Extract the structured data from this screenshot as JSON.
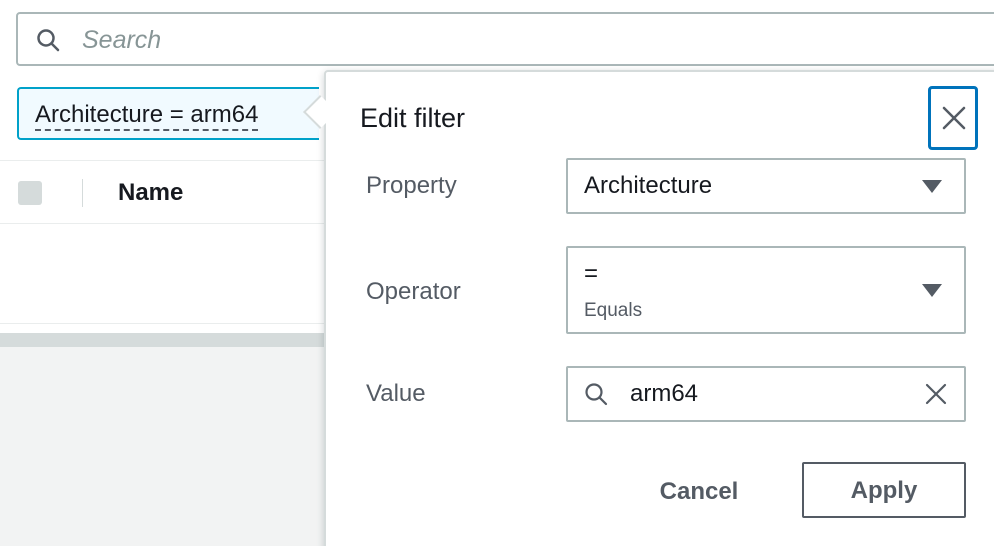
{
  "search": {
    "placeholder": "Search",
    "icon": "search-icon"
  },
  "filter_token": {
    "label": "Architecture = arm64"
  },
  "table": {
    "columns": [
      "Name"
    ]
  },
  "popover": {
    "title": "Edit filter",
    "close_icon": "close-icon",
    "property": {
      "label": "Property",
      "value": "Architecture"
    },
    "operator": {
      "label": "Operator",
      "value": "=",
      "description": "Equals"
    },
    "value_field": {
      "label": "Value",
      "value": "arm64"
    },
    "cancel_label": "Cancel",
    "apply_label": "Apply"
  },
  "colors": {
    "accent": "#0073bb",
    "token_border": "#00a1c9",
    "token_bg": "#f1faff",
    "border": "#aab7b8",
    "text": "#16191f",
    "secondary_text": "#545b64"
  }
}
